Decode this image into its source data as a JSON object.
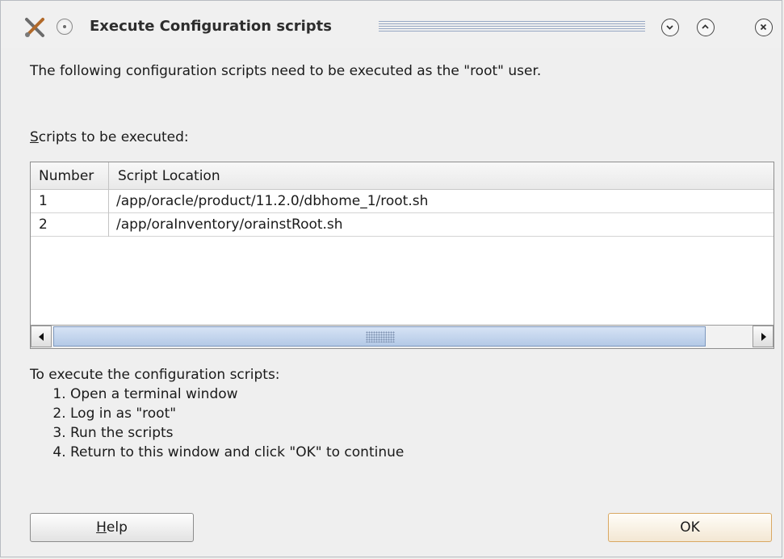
{
  "window": {
    "title": "Execute Configuration scripts"
  },
  "intro": "The following configuration scripts need to be executed as the \"root\" user.",
  "scripts_label": {
    "mnemonic": "S",
    "rest": "cripts to be executed:"
  },
  "table": {
    "columns": [
      "Number",
      "Script Location"
    ],
    "rows": [
      {
        "number": "1",
        "location": "/app/oracle/product/11.2.0/dbhome_1/root.sh"
      },
      {
        "number": "2",
        "location": "/app/oraInventory/orainstRoot.sh"
      }
    ]
  },
  "instructions": {
    "title": "To execute the configuration scripts:",
    "steps": [
      "Open a terminal window",
      "Log in as \"root\"",
      "Run the scripts",
      "Return to this window and click \"OK\" to continue"
    ]
  },
  "buttons": {
    "help_mnemonic": "H",
    "help_rest": "elp",
    "ok": "OK"
  },
  "icons": {
    "app": "tools-icon",
    "menu": "window-menu-icon",
    "minimize": "chevron-down-icon",
    "maximize": "chevron-up-icon",
    "close": "close-icon"
  },
  "colors": {
    "scroll_thumb": "#b4c9e6",
    "ok_border": "#d9a863"
  }
}
